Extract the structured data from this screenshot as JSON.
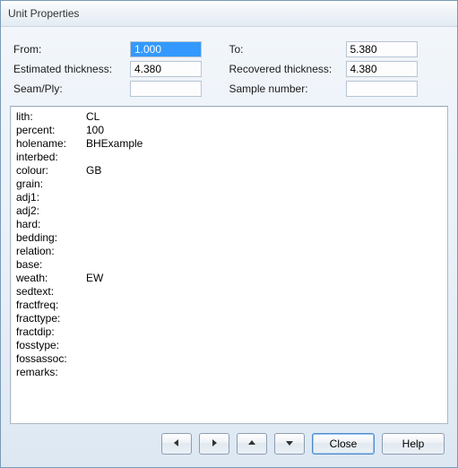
{
  "window": {
    "title": "Unit Properties"
  },
  "form": {
    "from": {
      "label": "From:",
      "value": "1.000"
    },
    "to": {
      "label": "To:",
      "value": "5.380"
    },
    "est_thickness": {
      "label": "Estimated thickness:",
      "value": "4.380"
    },
    "rec_thickness": {
      "label": "Recovered thickness:",
      "value": "4.380"
    },
    "seam_ply": {
      "label": "Seam/Ply:",
      "value": ""
    },
    "sample_number": {
      "label": "Sample number:",
      "value": ""
    }
  },
  "properties": [
    {
      "key": "lith:",
      "value": "CL"
    },
    {
      "key": "percent:",
      "value": "100"
    },
    {
      "key": "holename:",
      "value": "BHExample"
    },
    {
      "key": "interbed:",
      "value": ""
    },
    {
      "key": "colour:",
      "value": "GB"
    },
    {
      "key": "grain:",
      "value": ""
    },
    {
      "key": "adj1:",
      "value": ""
    },
    {
      "key": "adj2:",
      "value": ""
    },
    {
      "key": "hard:",
      "value": ""
    },
    {
      "key": "bedding:",
      "value": ""
    },
    {
      "key": "relation:",
      "value": ""
    },
    {
      "key": "base:",
      "value": ""
    },
    {
      "key": "weath:",
      "value": "EW"
    },
    {
      "key": "sedtext:",
      "value": ""
    },
    {
      "key": "fractfreq:",
      "value": ""
    },
    {
      "key": "fracttype:",
      "value": ""
    },
    {
      "key": "fractdip:",
      "value": ""
    },
    {
      "key": "fosstype:",
      "value": ""
    },
    {
      "key": "fossassoc:",
      "value": ""
    },
    {
      "key": "remarks:",
      "value": ""
    }
  ],
  "buttons": {
    "close": "Close",
    "help": "Help"
  },
  "icons": {
    "arrow_left": "triangle-left-icon",
    "arrow_right": "triangle-right-icon",
    "arrow_up": "triangle-up-icon",
    "arrow_down": "triangle-down-icon"
  }
}
